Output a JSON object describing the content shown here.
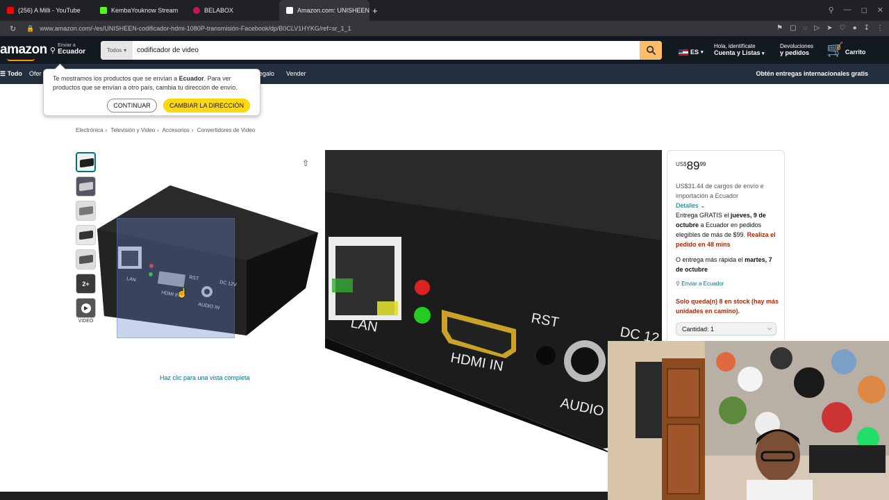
{
  "browser": {
    "tabs": [
      {
        "label": "(256) A Milli - YouTube",
        "color": "#ff0000"
      },
      {
        "label": "KembaYouknow Stream",
        "color": "#53fc18"
      },
      {
        "label": "BELABOX",
        "color": "#c2185b"
      },
      {
        "label": "Amazon.com: UNISHEEN",
        "color": "#ffffff"
      }
    ],
    "new_tab": "+",
    "url": "www.amazon.com/-/es/UNISHEEN-codificador-hdmi-1080P-transmisión-Facebook/dp/B0CLV1HYKG/ref=sr_1_1"
  },
  "header": {
    "logo": "amazon",
    "deliver_small": "Enviar a",
    "deliver_big": "Ecuador",
    "search_category": "Todos",
    "search_value": "codificador de video",
    "lang": "ES",
    "account_small": "Hola, identifícate",
    "account_big": "Cuenta y Listas",
    "returns_small": "Devoluciones",
    "returns_big": "y pedidos",
    "cart_count": "0",
    "cart_label": "Carrito"
  },
  "subnav": {
    "all": "Todo",
    "offers": "Ofer",
    "gift": "egalo",
    "sell": "Vender",
    "right": "Obtén entregas internacionales gratis"
  },
  "popover": {
    "text_1": "Te mostramos los productos que se envían a ",
    "country": "Ecuador",
    "text_2": ". Para ver productos que se envían a otro país, cambia tu dirección de envío.",
    "continue": "CONTINUAR",
    "change": "CAMBIAR LA DIRECCIÓN"
  },
  "breadcrumb": [
    "Electrónica",
    "Televisión y Video",
    "Accesorios",
    "Convertidores de Video"
  ],
  "breadcrumb_sep": "›",
  "thumbs": {
    "count_label": "2+",
    "video_label": "VIDEO"
  },
  "product": {
    "fullview": "Haz clic para una vista completa",
    "ports": {
      "lan": "LAN",
      "hdmi": "HDMI IN",
      "rst": "RST",
      "dc": "DC 12V",
      "audio": "AUDIO IN"
    },
    "zoom_labels": {
      "lan": "LAN",
      "hdmi": "HDMI IN",
      "rst": "RST",
      "dc": "DC 12",
      "audio": "AUDIO"
    }
  },
  "buybox": {
    "currency": "US$",
    "price_whole": "89",
    "price_frac": "99",
    "shipping": "US$31.44 de cargos de envío e importación a Ecuador",
    "details": "Detalles",
    "delivery_1": "Entrega GRATIS el ",
    "delivery_date": "jueves, 9 de octubre",
    "delivery_2": " a Ecuador en pedidos elegibles de más de $99. ",
    "delivery_cta": "Realiza el pedido en 48 mins",
    "fast_1": "O entrega más rápida el ",
    "fast_date": "martes, 7 de octubre",
    "ship_to": "Enviar a Ecuador",
    "stock": "Solo queda(n) 8 en stock (hay más unidades en camino).",
    "qty": "Cantidad: 1"
  },
  "colors": {
    "amazon_dark": "#131921",
    "amazon_nav": "#232f3e",
    "search_button": "#febd69",
    "link": "#007185",
    "alert_red": "#b12704",
    "cta_yellow": "#ffd814"
  }
}
